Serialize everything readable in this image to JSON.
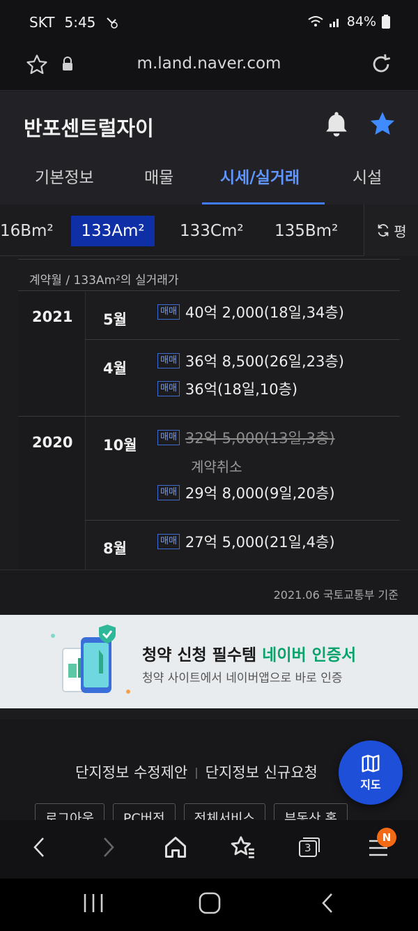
{
  "status_bar": {
    "carrier": "SKT",
    "time": "5:45",
    "battery": "84%"
  },
  "url_bar": {
    "url": "m.land.naver.com"
  },
  "header": {
    "complex_name": "반포센트럴자이"
  },
  "tabs": [
    {
      "label": "기본정보"
    },
    {
      "label": "매물"
    },
    {
      "label": "시세/실거래"
    },
    {
      "label": "시설"
    }
  ],
  "area_chips": [
    {
      "label": "16Bm²"
    },
    {
      "label": "133Am²"
    },
    {
      "label": "133Cm²"
    },
    {
      "label": "135Bm²"
    }
  ],
  "unit_toggle": {
    "label": "평"
  },
  "table": {
    "caption": "계약월 / 133Am²의 실거래가",
    "years": [
      {
        "year": "2021",
        "months": [
          {
            "month": "5월",
            "deals": [
              {
                "type": "매매",
                "price": "40억 2,000(18일,34층)"
              }
            ]
          },
          {
            "month": "4월",
            "deals": [
              {
                "type": "매매",
                "price": "36억 8,500(26일,23층)"
              },
              {
                "type": "매매",
                "price": "36억(18일,10층)"
              }
            ]
          }
        ]
      },
      {
        "year": "2020",
        "months": [
          {
            "month": "10월",
            "deals": [
              {
                "type": "매매",
                "price": "32억 5,000(13일,3층)",
                "note": "계약취소"
              },
              {
                "type": "매매",
                "price": "29억 8,000(9일,20층)"
              }
            ]
          },
          {
            "month": "8월",
            "deals": [
              {
                "type": "매매",
                "price": "27억 5,000(21일,4층)"
              }
            ]
          }
        ]
      }
    ],
    "source": "2021.06 국토교통부 기준"
  },
  "banner": {
    "title_main": "청약 신청 필수템",
    "title_accent": "네이버 인증서",
    "subtitle": "청약 사이트에서 네이버앱으로 바로 인증"
  },
  "footer": {
    "link_1": "단지정보 수정제안",
    "link_2": "단지정보 신규요청",
    "buttons": [
      "로그아웃",
      "PC버전",
      "전체서비스",
      "부동산 홈"
    ]
  },
  "map_button": {
    "label": "지도"
  },
  "browser_nav": {
    "tabs_count": "3",
    "notification_badge": "N"
  },
  "colors": {
    "accent": "#3f7bff",
    "chip_active": "#0f2fa6",
    "banner_green": "#0aa36c",
    "fab": "#1e4fd8"
  }
}
